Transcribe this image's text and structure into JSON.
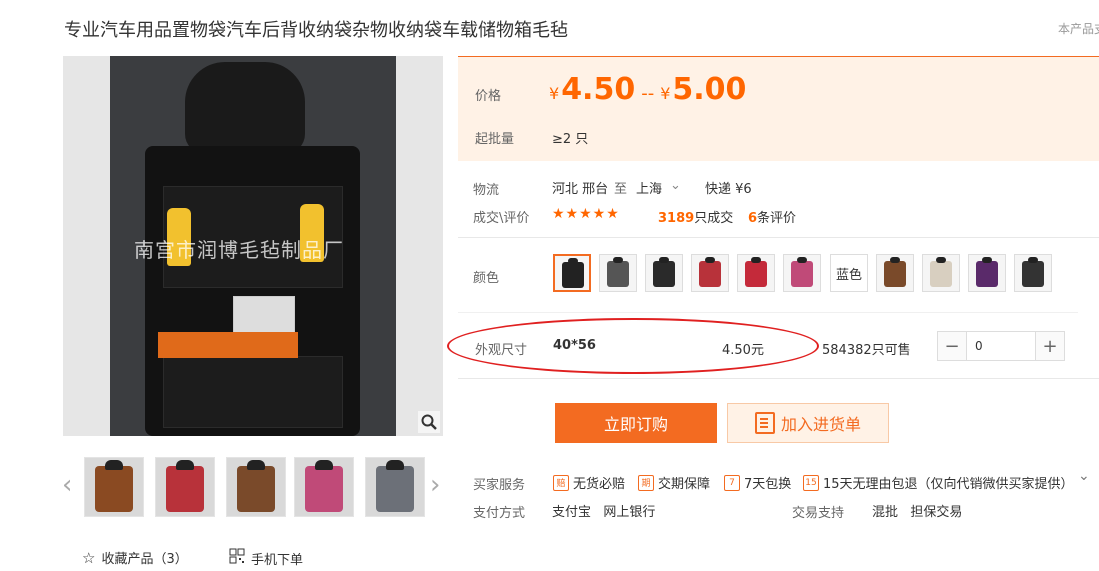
{
  "product": {
    "title": "专业汽车用品置物袋汽车后背收纳袋杂物收纳袋车载储物箱毛毡",
    "side_note": "本产品支"
  },
  "gallery": {
    "watermark": "南宫市润博毛毡制品厂",
    "zoom_icon": "magnifier-icon",
    "thumb_colors": [
      "#8a4a22",
      "#b8323a",
      "#7a4a2a",
      "#c04a78",
      "#6c7078"
    ]
  },
  "bottom_links": {
    "favorite_label": "收藏产品（3）",
    "mobile_label": "手机下单"
  },
  "price": {
    "label": "价格",
    "currency": "¥",
    "low": "4.50",
    "separator": "--",
    "high": "5.00",
    "moq_label": "起批量",
    "moq_value": "≥2 只"
  },
  "logistics": {
    "label": "物流",
    "from": "河北 邢台",
    "to_word": "至",
    "to": "上海",
    "express": "快递 ¥6"
  },
  "trade": {
    "label": "成交\\评价",
    "stars": "★★★★★",
    "deals_count": "3189",
    "deals_text": "只成交",
    "reviews_count": "6",
    "reviews_text": "条评价"
  },
  "color": {
    "label": "颜色",
    "swatch_colors": [
      "#222222",
      "#555555",
      "#2a2a2a",
      "#b8323a",
      "#c42a3a",
      "#c04a78",
      "#7a4a2a",
      "#d8cfc0",
      "#5a2a6a",
      "#333333"
    ],
    "text_option": "蓝色"
  },
  "size": {
    "label": "外观尺寸",
    "value": "40*56",
    "price": "4.50元",
    "stock": "584382只可售",
    "qty": "0",
    "minus": "−",
    "plus": "+"
  },
  "actions": {
    "buy_label": "立即订购",
    "cart_label": "加入进货单"
  },
  "services": {
    "label": "买家服务",
    "items": [
      {
        "icon": "赔",
        "text": "无货必赔"
      },
      {
        "icon": "期",
        "text": "交期保障"
      },
      {
        "icon": "7",
        "text": "7天包换"
      },
      {
        "icon": "15",
        "text": "15天无理由包退（仅向代销微供买家提供）"
      }
    ]
  },
  "payment": {
    "label": "支付方式",
    "methods": "支付宝   网上银行",
    "trade_label": "交易支持",
    "trade_methods": "混批   担保交易"
  }
}
